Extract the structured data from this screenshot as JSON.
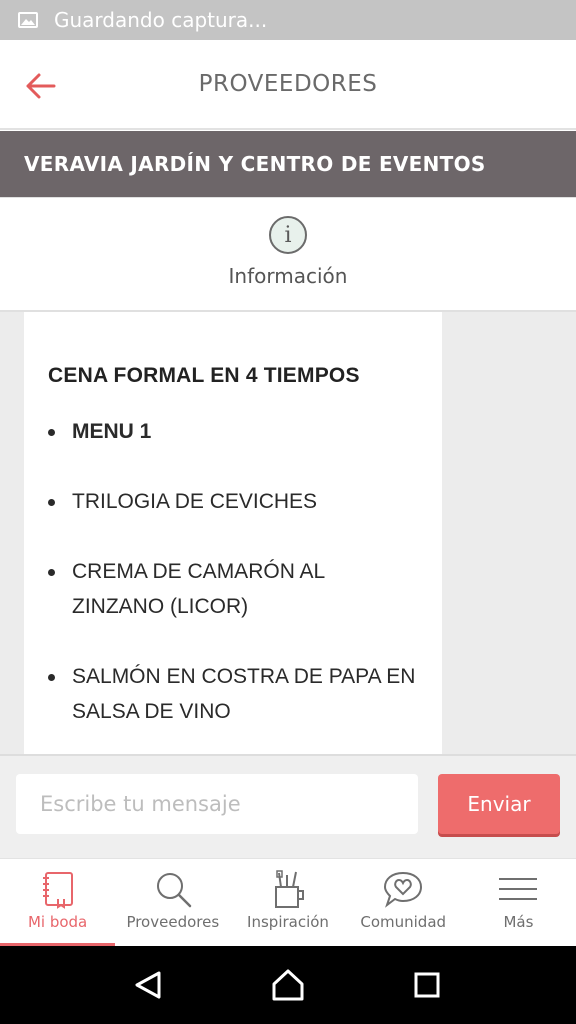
{
  "status_bar": {
    "text": "Guardando captura...",
    "icon": "image-icon"
  },
  "header": {
    "title": "PROVEEDORES",
    "back_icon": "arrow-left-icon"
  },
  "vendor": {
    "name": "VERAVIA JARDÍN Y CENTRO DE EVENTOS"
  },
  "info_tab": {
    "label": "Información",
    "icon": "info-icon"
  },
  "card": {
    "heading": "CENA FORMAL EN 4 TIEMPOS",
    "items": [
      {
        "text": "MENU 1"
      },
      {
        "text": "TRILOGIA DE CEVICHES"
      },
      {
        "text": "CREMA DE CAMARÓN AL ZINZANO (LICOR)"
      },
      {
        "text": "SALMÓN EN COSTRA DE PAPA EN SALSA DE VINO"
      }
    ]
  },
  "message": {
    "placeholder": "Escribe tu mensaje",
    "send_label": "Enviar"
  },
  "bottom_nav": {
    "items": [
      {
        "label": "Mi boda",
        "icon": "notebook-icon",
        "active": true
      },
      {
        "label": "Proveedores",
        "icon": "search-icon",
        "active": false
      },
      {
        "label": "Inspiración",
        "icon": "brushes-icon",
        "active": false
      },
      {
        "label": "Comunidad",
        "icon": "chat-heart-icon",
        "active": false
      },
      {
        "label": "Más",
        "icon": "menu-icon",
        "active": false
      }
    ]
  },
  "colors": {
    "accent": "#ee6c6c",
    "vendor_bar": "#6d6669",
    "status_bar": "#c4c4c4"
  }
}
